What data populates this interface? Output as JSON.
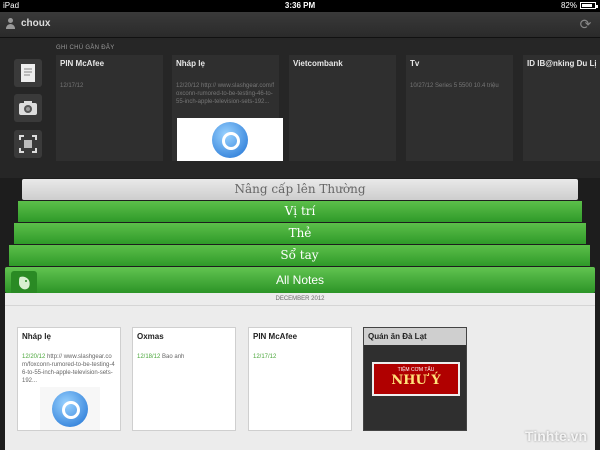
{
  "status_bar": {
    "device": "iPad",
    "time": "3:36 PM",
    "battery": "82%",
    "battery_level": 0.82
  },
  "header": {
    "username": "choux"
  },
  "recent": {
    "label": "GHI CHÚ GẦN ĐÂY",
    "cards": [
      {
        "title": "PIN McAfee",
        "meta": "12/17/12"
      },
      {
        "title": "Nháp lẹ",
        "meta": "12/20/12 http:// www.slashgear.com/foxconn-rumored-to-be-testing-46-to-55-inch-apple-television-sets-192..."
      },
      {
        "title": "Vietcombank",
        "meta": ""
      },
      {
        "title": "Tv",
        "meta": "10/27/12 Series 5 5500 10.4 triệu"
      },
      {
        "title": "ID IB@nking Du Lị...",
        "meta": ""
      }
    ]
  },
  "stack": {
    "upgrade": "Nâng cấp lên Thường",
    "location": "Vị trí",
    "tags": "Thẻ",
    "notebooks": "Sổ tay",
    "all_notes": "All Notes"
  },
  "notes": {
    "month": "DECEMBER 2012",
    "cards": [
      {
        "title": "Nháp lẹ",
        "date": "12/20/12",
        "text": "http:// www.slashgear.com/foxconn-rumored-to-be-testing-46-to-55-inch-apple-television-sets-192..."
      },
      {
        "title": "Oxmas",
        "date": "12/18/12",
        "text": "Bao anh"
      },
      {
        "title": "PIN McAfee",
        "date": "12/17/12",
        "text": ""
      },
      {
        "title": "Quán ăn Đà Lạt",
        "sign_top": "TIỆM CƠM TẤU",
        "sign_big": "NHƯ Ý"
      }
    ]
  },
  "watermark": "Tinhte.vn",
  "colors": {
    "green": "#3ea634",
    "date_green": "#4aa63a"
  }
}
